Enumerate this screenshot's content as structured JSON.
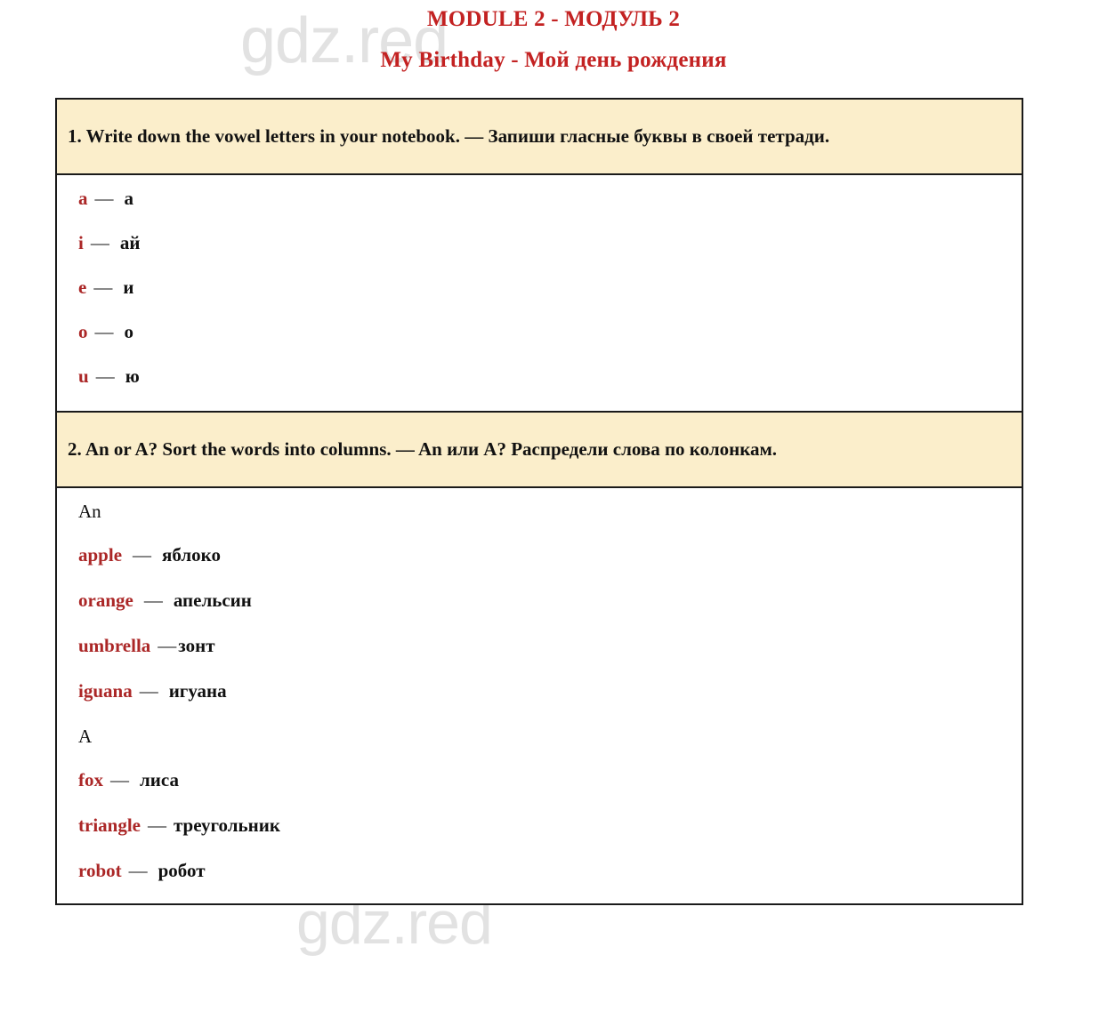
{
  "page": {
    "watermark": "gdz.red",
    "accent_red": "#ab2727",
    "title_red": "#c32222",
    "task_bg": "#fbeecb",
    "border_color": "#1a1a1a"
  },
  "heading": {
    "line1": "MODULE 2 - МОДУЛЬ 2",
    "line2": "My Birthday - Мой день рождения"
  },
  "exercises": [
    {
      "number": "1.",
      "task": "1. Write down the vowel letters in your notebook. — Запиши гласные буквы в своей тетради.",
      "answer_kind": "pairs",
      "pairs": [
        {
          "en": "a",
          "dash": "—",
          "ru": "а"
        },
        {
          "en": "i",
          "dash": "—",
          "ru": "ай"
        },
        {
          "en": "e",
          "dash": "—",
          "ru": "и"
        },
        {
          "en": "o",
          "dash": "—",
          "ru": "о"
        },
        {
          "en": "u",
          "dash": "—",
          "ru": "ю"
        }
      ]
    },
    {
      "number": "2.",
      "task": "2. An or A? Sort the words into columns. — An или A? Распредели слова по колонкам.",
      "answer_kind": "groups",
      "groups": [
        {
          "label": "An",
          "pairs": [
            {
              "en": "apple",
              "dash": "—",
              "ru": "яблоко"
            },
            {
              "en": "orange",
              "dash": "—",
              "ru": "апельсин"
            },
            {
              "en": "umbrella",
              "dash": "—",
              "ru": "зонт"
            },
            {
              "en": "iguana",
              "dash": "—",
              "ru": "игуана"
            }
          ]
        },
        {
          "label": "A",
          "pairs": [
            {
              "en": "fox",
              "dash": "—",
              "ru": "лиса"
            },
            {
              "en": "triangle",
              "dash": "—",
              "ru": "треугольник"
            },
            {
              "en": "robot",
              "dash": "—",
              "ru": "робот"
            }
          ]
        }
      ]
    }
  ]
}
